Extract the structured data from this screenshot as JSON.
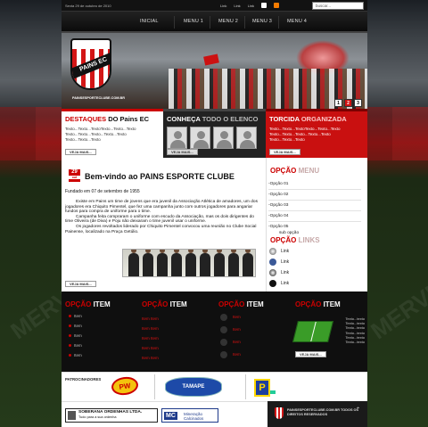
{
  "topbar": {
    "date": "Sexta 29 de outubro de 2010",
    "links": [
      "Link",
      "Link",
      "Link"
    ],
    "search_placeholder": "buscar..."
  },
  "nav": [
    "INICIAL",
    "MENU 1",
    "MENU 2",
    "MENU 3",
    "MENU 4"
  ],
  "banner": {
    "logo_text": "PAINS EC",
    "site": "PAINSESPORTECLUBE.COM.BR",
    "pager": [
      "1",
      "2",
      "3"
    ]
  },
  "features": [
    {
      "title_red": "DESTAQUES",
      "title_rest": "DO Pains EC",
      "text": "Texto...Texto...TextoTexto...Texto...Texto Texto...Texto...Texto...Texto...Texto Texto...Texto...Texto",
      "more": "VEJA MAIS..."
    },
    {
      "title_red": "CONHEÇA",
      "title_rest": "TODO O ELENCO",
      "more": "VEJA MAIS..."
    },
    {
      "title_red": "TORCIDA",
      "title_rest": "ORGANIZADA",
      "text": "Texto...Texto...TextoTexto...Texto...Texto Texto...Texto...Texto...Texto...Texto Texto...Texto...Texto",
      "more": "VEJA MAIS..."
    }
  ],
  "main": {
    "date_day": "29",
    "date_month": "out",
    "title": "Bem-vindo ao PAINS ESPORTE CLUBE",
    "founded": "Fundado em 07 de setembro de 1955",
    "p1": "Existe em Pains um time de jovens que era juvenil da Associação Atlética de amadores, um dos jogadores era Chiquito Pimentel, que fez uma campanha junto com outros jogadores para angariar fundos para compra de uniforme para o time.",
    "p2": "Campanha feita compraram o uniforme com escudo da Associação, mas os dois dirigentes do time Oliveira (de Diva) e Poju não deixaram o time juvenil usar o uniforme.",
    "p3": "Os jogadores revoltados liderado por Chiquito Pimentel convocou uma reunião no Clube Social Painense, localizado na Praça Getúlio.",
    "more": "VEJA MAIS..."
  },
  "side": {
    "menu_title": "OPÇÃO",
    "menu_title2": "MENU",
    "options": [
      "-Opção 01",
      "-Opção 02",
      "-Opção 03",
      "-Opção 04",
      "-Opção 05"
    ],
    "sub": "sub opção",
    "links_title": "OPÇÃO",
    "links_title2": "LINKS",
    "links": [
      "Link",
      "Link",
      "Link",
      "Link"
    ]
  },
  "footer_cols": [
    {
      "t1": "OPÇÃO",
      "t2": "ITEM",
      "items": [
        "Item",
        "Item",
        "Item",
        "Item",
        "Item"
      ]
    },
    {
      "t1": "OPÇÃO",
      "t2": "ITEM",
      "items": [
        "Item Item",
        "Item Item",
        "Item Item",
        "Item Item",
        "Item Item"
      ]
    },
    {
      "t1": "OPÇÃO",
      "t2": "ITEM",
      "items": [
        "Item",
        "Item",
        "Item",
        "Item"
      ]
    },
    {
      "t1": "OPÇÃO",
      "t2": "ITEM",
      "text": "Texto...texto Texto...texto Texto...texto Texto...texto Texto...texto Texto...texto",
      "more": "VEJA MAIS..."
    }
  ],
  "sponsors": {
    "label": "PATROCINADORES",
    "s1": "PW",
    "s2": "TAMAPE",
    "s3": "P",
    "s4": "SOBERANA ORDENHAS LTDA.",
    "s4b": "Tudo para a sua ordenha",
    "s5a": "MC",
    "s5": "Mineração Calcinados",
    "footer": "PAINSESPORTECLUBE.COM.BR TODOS OS DIREITOS RESERVADOS"
  },
  "colors": {
    "accent": "#c00000",
    "dark": "#0f0f0f"
  }
}
